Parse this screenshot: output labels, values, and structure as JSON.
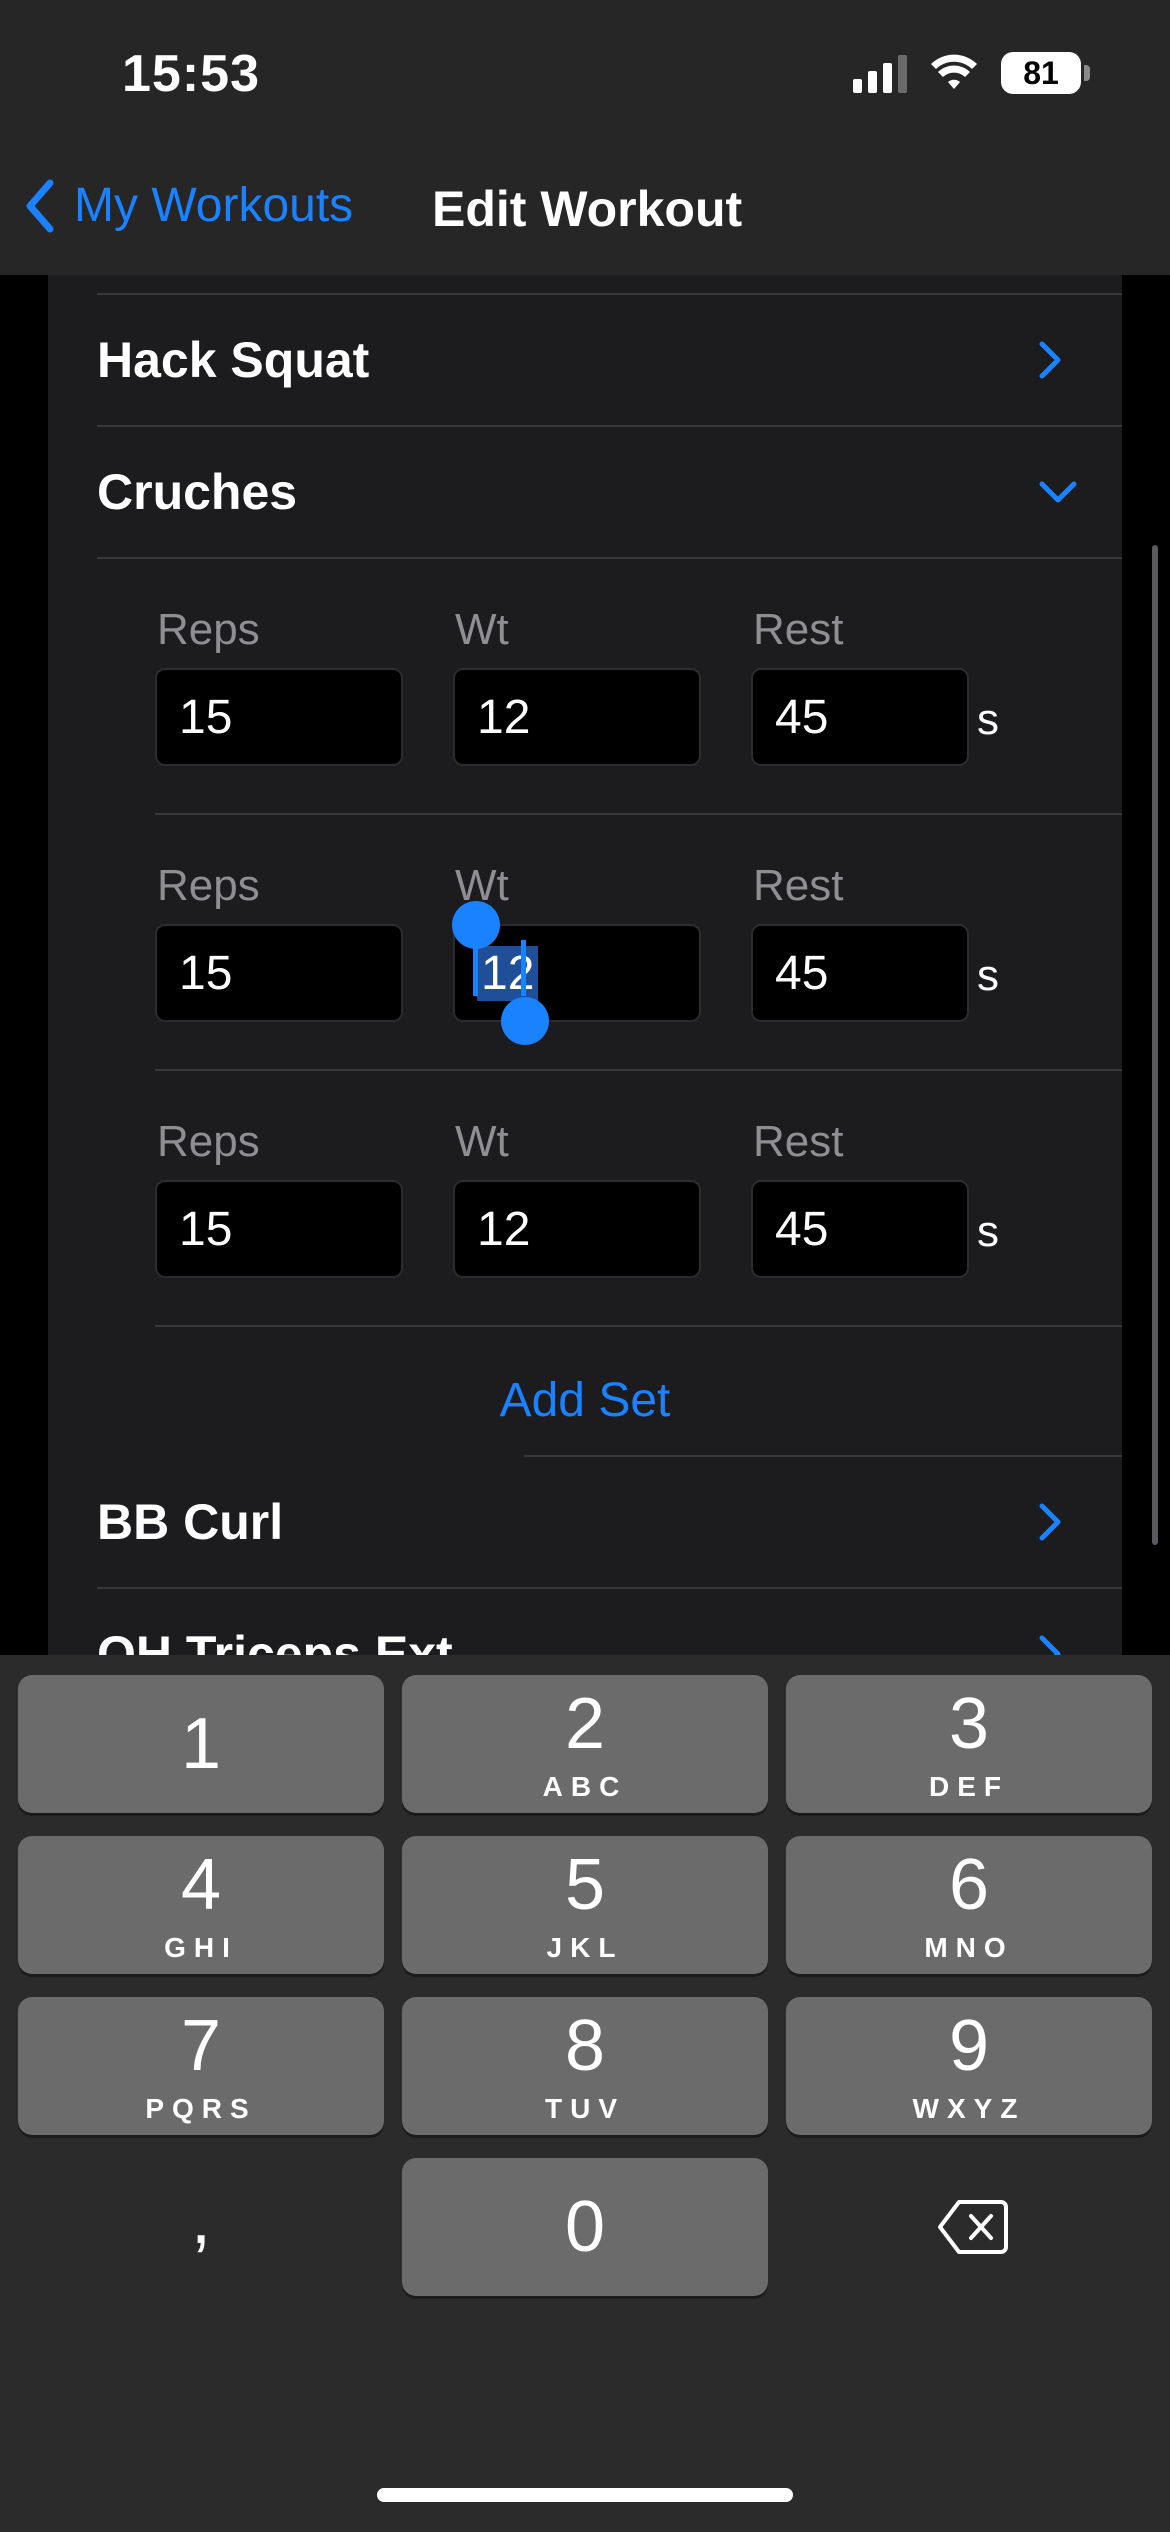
{
  "status": {
    "time": "15:53",
    "battery": "81"
  },
  "nav": {
    "back_label": "My Workouts",
    "title": "Edit Workout"
  },
  "exercises": {
    "hack_squat": "Hack Squat",
    "cruches": "Cruches",
    "bb_curl": "BB Curl",
    "oh_triceps": "OH Triceps Ext"
  },
  "sets": [
    {
      "reps_label": "Reps",
      "wt_label": "Wt",
      "rest_label": "Rest",
      "reps": "15",
      "wt": "12",
      "rest": "45",
      "unit": "s"
    },
    {
      "reps_label": "Reps",
      "wt_label": "Wt",
      "rest_label": "Rest",
      "reps": "15",
      "wt": "12",
      "rest": "45",
      "unit": "s"
    },
    {
      "reps_label": "Reps",
      "wt_label": "Wt",
      "rest_label": "Rest",
      "reps": "15",
      "wt": "12",
      "rest": "45",
      "unit": "s"
    }
  ],
  "add_set_label": "Add Set",
  "keyboard": {
    "k1": {
      "num": "1",
      "letters": ""
    },
    "k2": {
      "num": "2",
      "letters": "ABC"
    },
    "k3": {
      "num": "3",
      "letters": "DEF"
    },
    "k4": {
      "num": "4",
      "letters": "GHI"
    },
    "k5": {
      "num": "5",
      "letters": "JKL"
    },
    "k6": {
      "num": "6",
      "letters": "MNO"
    },
    "k7": {
      "num": "7",
      "letters": "PQRS"
    },
    "k8": {
      "num": "8",
      "letters": "TUV"
    },
    "k9": {
      "num": "9",
      "letters": "WXYZ"
    },
    "k0": {
      "num": "0"
    },
    "comma": ","
  },
  "colors": {
    "accent": "#1a82ff",
    "background": "#000000",
    "card": "#1c1c1e",
    "keyboard": "#2b2b2b",
    "key": "#6b6b6b"
  }
}
